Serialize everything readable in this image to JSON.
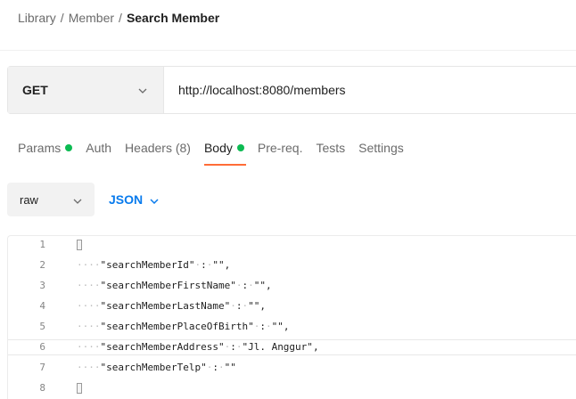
{
  "breadcrumb": {
    "items": [
      "Library",
      "Member"
    ],
    "separator": "/",
    "current": "Search Member"
  },
  "request": {
    "method": "GET",
    "url": "http://localhost:8080/members"
  },
  "tabs": [
    {
      "label": "Params",
      "has_dot": true
    },
    {
      "label": "Auth",
      "has_dot": false
    },
    {
      "label": "Headers (8)",
      "has_dot": false
    },
    {
      "label": "Body",
      "has_dot": true,
      "active": true
    },
    {
      "label": "Pre-req.",
      "has_dot": false
    },
    {
      "label": "Tests",
      "has_dot": false
    },
    {
      "label": "Settings",
      "has_dot": false
    }
  ],
  "body_options": {
    "mode": "raw",
    "language": "JSON"
  },
  "editor": {
    "lines": [
      {
        "num": "1",
        "text": "{"
      },
      {
        "num": "2",
        "key": "\"searchMemberId\"",
        "value": "\"\"",
        "comma": true
      },
      {
        "num": "3",
        "key": "\"searchMemberFirstName\"",
        "value": "\"\"",
        "comma": true
      },
      {
        "num": "4",
        "key": "\"searchMemberLastName\"",
        "value": "\"\"",
        "comma": true
      },
      {
        "num": "5",
        "key": "\"searchMemberPlaceOfBirth\"",
        "value": "\"\"",
        "comma": true
      },
      {
        "num": "6",
        "key": "\"searchMemberAddress\"",
        "value": "\"Jl. Anggur\"",
        "comma": true
      },
      {
        "num": "7",
        "key": "\"searchMemberTelp\"",
        "value": "\"\"",
        "comma": false
      },
      {
        "num": "8",
        "text": "}"
      }
    ]
  },
  "colors": {
    "dot_green": "#0cbb52",
    "active_underline": "#ff6c37",
    "json_blue": "#097bed"
  }
}
